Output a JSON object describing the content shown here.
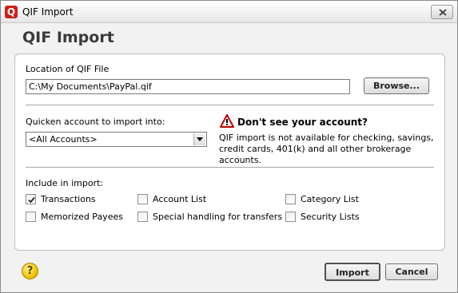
{
  "window": {
    "title": "QIF Import",
    "app_icon_glyph": "Q",
    "close_glyph": "close-icon"
  },
  "heading": "QIF Import",
  "file_section": {
    "label": "Location of QIF File",
    "path_value": "C:\\My Documents\\PayPal.qif",
    "browse_label": "Browse..."
  },
  "account_section": {
    "label": "Quicken account to import into:",
    "selected": "<All Accounts>",
    "warning_title": "Don't see your account?",
    "warning_text": "QIF import is not available for checking, savings, credit cards, 401(k) and all other brokerage accounts."
  },
  "include_section": {
    "label": "Include in import:",
    "options": [
      {
        "label": "Transactions",
        "checked": true
      },
      {
        "label": "Account List",
        "checked": false
      },
      {
        "label": "Category List",
        "checked": false
      },
      {
        "label": "Memorized Payees",
        "checked": false
      },
      {
        "label": "Special handling for transfers",
        "checked": false
      },
      {
        "label": "Security Lists",
        "checked": false
      }
    ]
  },
  "footer": {
    "help_glyph": "?",
    "import_label": "Import",
    "cancel_label": "Cancel"
  },
  "colors": {
    "brand": "#c9221b",
    "warning": "#c00000",
    "heading": "#3a3a3a"
  }
}
